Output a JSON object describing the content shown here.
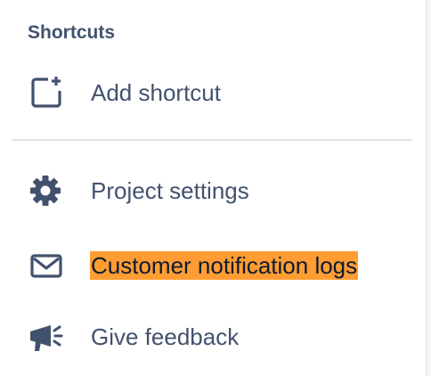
{
  "shortcuts": {
    "title": "Shortcuts",
    "add_label": "Add shortcut"
  },
  "menu": {
    "project_settings_label": "Project settings",
    "notification_logs_label": "Customer notification logs",
    "feedback_label": "Give feedback"
  },
  "icons": {
    "add_shortcut": "add-shortcut-icon",
    "settings": "gear-icon",
    "notifications": "envelope-icon",
    "feedback": "megaphone-icon"
  },
  "colors": {
    "text": "#42526e",
    "highlight": "#ff9d33",
    "divider": "#dfe1e6"
  }
}
